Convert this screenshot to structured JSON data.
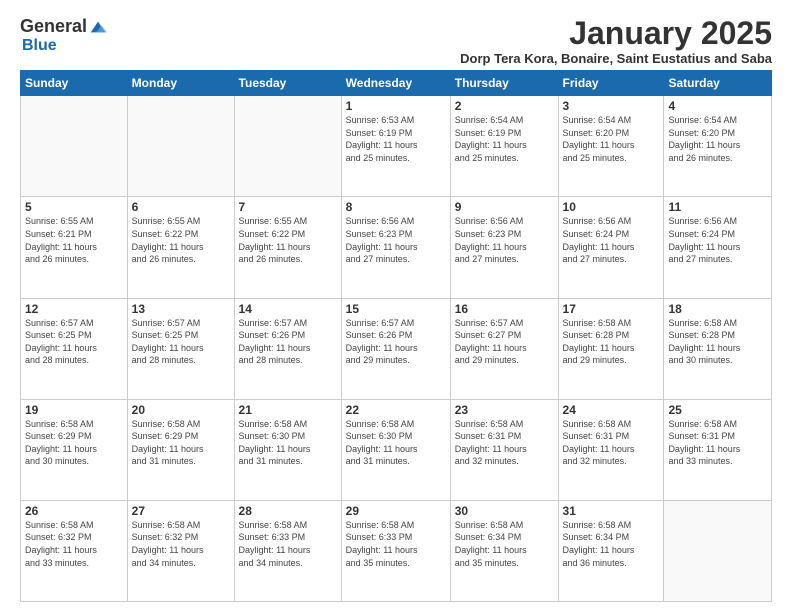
{
  "logo": {
    "general": "General",
    "blue": "Blue"
  },
  "title": "January 2025",
  "location": "Dorp Tera Kora, Bonaire, Saint Eustatius and Saba",
  "days_of_week": [
    "Sunday",
    "Monday",
    "Tuesday",
    "Wednesday",
    "Thursday",
    "Friday",
    "Saturday"
  ],
  "weeks": [
    [
      {
        "day": "",
        "info": ""
      },
      {
        "day": "",
        "info": ""
      },
      {
        "day": "",
        "info": ""
      },
      {
        "day": "1",
        "info": "Sunrise: 6:53 AM\nSunset: 6:19 PM\nDaylight: 11 hours\nand 25 minutes."
      },
      {
        "day": "2",
        "info": "Sunrise: 6:54 AM\nSunset: 6:19 PM\nDaylight: 11 hours\nand 25 minutes."
      },
      {
        "day": "3",
        "info": "Sunrise: 6:54 AM\nSunset: 6:20 PM\nDaylight: 11 hours\nand 25 minutes."
      },
      {
        "day": "4",
        "info": "Sunrise: 6:54 AM\nSunset: 6:20 PM\nDaylight: 11 hours\nand 26 minutes."
      }
    ],
    [
      {
        "day": "5",
        "info": "Sunrise: 6:55 AM\nSunset: 6:21 PM\nDaylight: 11 hours\nand 26 minutes."
      },
      {
        "day": "6",
        "info": "Sunrise: 6:55 AM\nSunset: 6:22 PM\nDaylight: 11 hours\nand 26 minutes."
      },
      {
        "day": "7",
        "info": "Sunrise: 6:55 AM\nSunset: 6:22 PM\nDaylight: 11 hours\nand 26 minutes."
      },
      {
        "day": "8",
        "info": "Sunrise: 6:56 AM\nSunset: 6:23 PM\nDaylight: 11 hours\nand 27 minutes."
      },
      {
        "day": "9",
        "info": "Sunrise: 6:56 AM\nSunset: 6:23 PM\nDaylight: 11 hours\nand 27 minutes."
      },
      {
        "day": "10",
        "info": "Sunrise: 6:56 AM\nSunset: 6:24 PM\nDaylight: 11 hours\nand 27 minutes."
      },
      {
        "day": "11",
        "info": "Sunrise: 6:56 AM\nSunset: 6:24 PM\nDaylight: 11 hours\nand 27 minutes."
      }
    ],
    [
      {
        "day": "12",
        "info": "Sunrise: 6:57 AM\nSunset: 6:25 PM\nDaylight: 11 hours\nand 28 minutes."
      },
      {
        "day": "13",
        "info": "Sunrise: 6:57 AM\nSunset: 6:25 PM\nDaylight: 11 hours\nand 28 minutes."
      },
      {
        "day": "14",
        "info": "Sunrise: 6:57 AM\nSunset: 6:26 PM\nDaylight: 11 hours\nand 28 minutes."
      },
      {
        "day": "15",
        "info": "Sunrise: 6:57 AM\nSunset: 6:26 PM\nDaylight: 11 hours\nand 29 minutes."
      },
      {
        "day": "16",
        "info": "Sunrise: 6:57 AM\nSunset: 6:27 PM\nDaylight: 11 hours\nand 29 minutes."
      },
      {
        "day": "17",
        "info": "Sunrise: 6:58 AM\nSunset: 6:28 PM\nDaylight: 11 hours\nand 29 minutes."
      },
      {
        "day": "18",
        "info": "Sunrise: 6:58 AM\nSunset: 6:28 PM\nDaylight: 11 hours\nand 30 minutes."
      }
    ],
    [
      {
        "day": "19",
        "info": "Sunrise: 6:58 AM\nSunset: 6:29 PM\nDaylight: 11 hours\nand 30 minutes."
      },
      {
        "day": "20",
        "info": "Sunrise: 6:58 AM\nSunset: 6:29 PM\nDaylight: 11 hours\nand 31 minutes."
      },
      {
        "day": "21",
        "info": "Sunrise: 6:58 AM\nSunset: 6:30 PM\nDaylight: 11 hours\nand 31 minutes."
      },
      {
        "day": "22",
        "info": "Sunrise: 6:58 AM\nSunset: 6:30 PM\nDaylight: 11 hours\nand 31 minutes."
      },
      {
        "day": "23",
        "info": "Sunrise: 6:58 AM\nSunset: 6:31 PM\nDaylight: 11 hours\nand 32 minutes."
      },
      {
        "day": "24",
        "info": "Sunrise: 6:58 AM\nSunset: 6:31 PM\nDaylight: 11 hours\nand 32 minutes."
      },
      {
        "day": "25",
        "info": "Sunrise: 6:58 AM\nSunset: 6:31 PM\nDaylight: 11 hours\nand 33 minutes."
      }
    ],
    [
      {
        "day": "26",
        "info": "Sunrise: 6:58 AM\nSunset: 6:32 PM\nDaylight: 11 hours\nand 33 minutes."
      },
      {
        "day": "27",
        "info": "Sunrise: 6:58 AM\nSunset: 6:32 PM\nDaylight: 11 hours\nand 34 minutes."
      },
      {
        "day": "28",
        "info": "Sunrise: 6:58 AM\nSunset: 6:33 PM\nDaylight: 11 hours\nand 34 minutes."
      },
      {
        "day": "29",
        "info": "Sunrise: 6:58 AM\nSunset: 6:33 PM\nDaylight: 11 hours\nand 35 minutes."
      },
      {
        "day": "30",
        "info": "Sunrise: 6:58 AM\nSunset: 6:34 PM\nDaylight: 11 hours\nand 35 minutes."
      },
      {
        "day": "31",
        "info": "Sunrise: 6:58 AM\nSunset: 6:34 PM\nDaylight: 11 hours\nand 36 minutes."
      },
      {
        "day": "",
        "info": ""
      }
    ]
  ]
}
